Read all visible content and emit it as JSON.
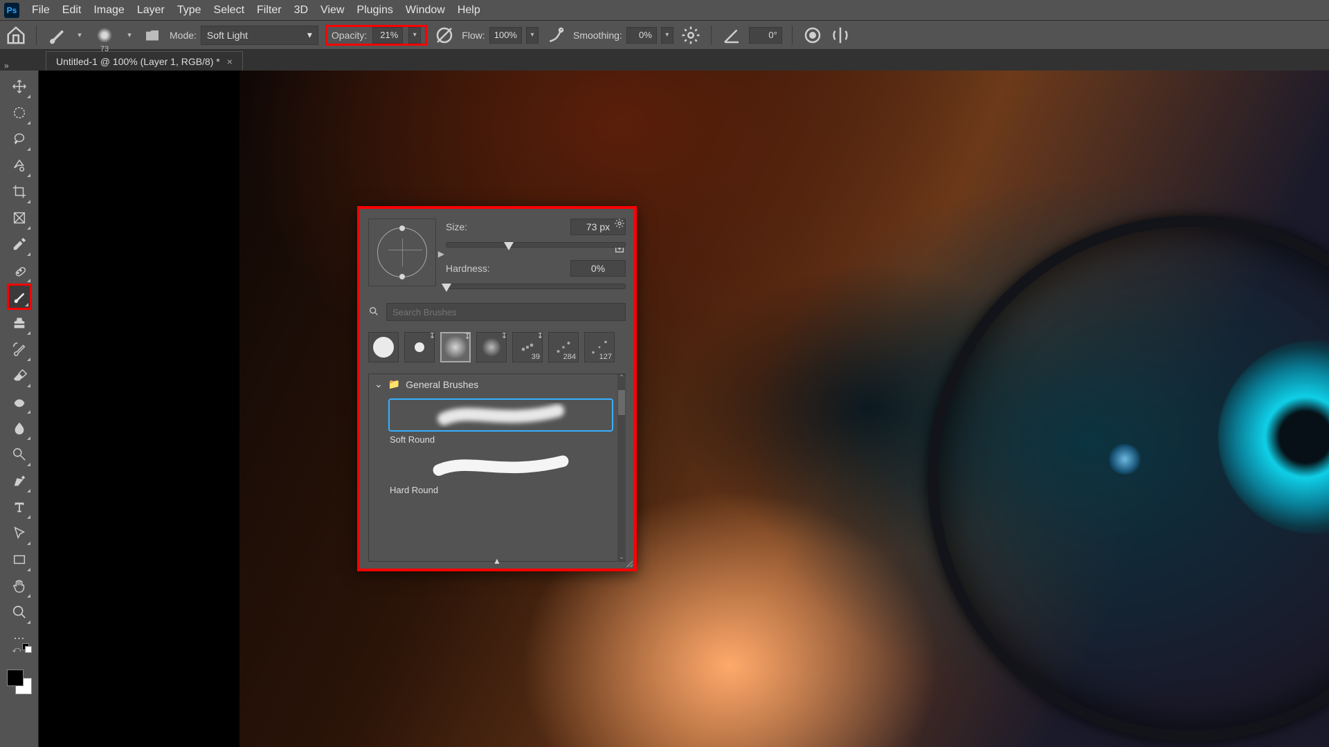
{
  "menu": {
    "items": [
      "File",
      "Edit",
      "Image",
      "Layer",
      "Type",
      "Select",
      "Filter",
      "3D",
      "View",
      "Plugins",
      "Window",
      "Help"
    ]
  },
  "optbar": {
    "brush_size": "73",
    "mode_label": "Mode:",
    "mode_value": "Soft Light",
    "opacity_label": "Opacity:",
    "opacity_value": "21%",
    "flow_label": "Flow:",
    "flow_value": "100%",
    "smoothing_label": "Smoothing:",
    "smoothing_value": "0%",
    "angle_value": "0°"
  },
  "doc_tab": {
    "title": "Untitled-1 @ 100% (Layer 1, RGB/8) *"
  },
  "brush_popup": {
    "size_label": "Size:",
    "size_value": "73 px",
    "hardness_label": "Hardness:",
    "hardness_value": "0%",
    "search_placeholder": "Search Brushes",
    "recent_numbers": [
      "",
      "",
      "",
      "",
      "39",
      "284",
      "127"
    ],
    "folder_name": "General Brushes",
    "brushes": [
      {
        "name": "Soft Round",
        "selected": true
      },
      {
        "name": "Hard Round",
        "selected": false
      }
    ]
  }
}
